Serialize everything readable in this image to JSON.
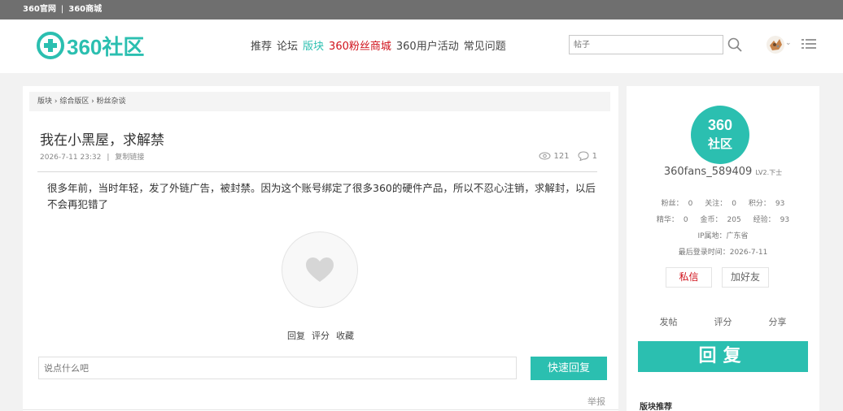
{
  "topbar": {
    "link1": "360官网",
    "sep": "|",
    "link2": "360商城"
  },
  "header": {
    "logo_text": "360社区",
    "nav": [
      {
        "label": "推荐",
        "state": "normal"
      },
      {
        "label": "论坛",
        "state": "normal"
      },
      {
        "label": "版块",
        "state": "active"
      },
      {
        "label": "360粉丝商城",
        "state": "red"
      },
      {
        "label": "360用户活动",
        "state": "normal"
      },
      {
        "label": "常见问题",
        "state": "normal"
      }
    ],
    "search_placeholder": "帖子",
    "icons": {
      "search": "search-icon",
      "avatar": "user-avatar",
      "menu": "list-menu-icon",
      "dropdown": "chevron-down-icon"
    }
  },
  "post": {
    "breadcrumb": "版块 › 综合版区 › 粉丝杂谈",
    "title": "我在小黑屋，求解禁",
    "date": "2026-7-11 23:32",
    "meta_sep": "|",
    "copy_link": "复制链接",
    "views": "121",
    "replies": "1",
    "content": "很多年前，当时年轻，发了外链广告，被封禁。因为这个账号绑定了很多360的硬件产品，所以不忍心注销，求解封，以后不会再犯错了",
    "actions": {
      "reply": "回复",
      "rate": "评分",
      "favorite": "收藏"
    },
    "reply_placeholder": "说点什么吧",
    "quick_reply": "快速回复",
    "report": "举报"
  },
  "sidebar": {
    "avatar_line1": "360",
    "avatar_line2": "社区",
    "username": "360fans_589409",
    "level": "LV2.下士",
    "fans_label": "粉丝：",
    "fans": "0",
    "follow_label": "关注：",
    "follow": "0",
    "points_label": "积分：",
    "points": "93",
    "elite_label": "精华：",
    "elite": "0",
    "coins_label": "金币：",
    "coins": "205",
    "exp_label": "经验：",
    "exp": "93",
    "ip_label": "IP属地：",
    "ip": "广东省",
    "last_login_label": "最后登录时间：",
    "last_login": "2026-7-11",
    "pm_button": "私信",
    "add_friend_button": "加好友",
    "tabs": [
      "发帖",
      "评分",
      "分享"
    ],
    "big_reply": "回复",
    "board_recommend": "版块推荐"
  },
  "colors": {
    "accent": "#2bbfb0",
    "red": "#d0121b",
    "topbar": "#6f6f6f"
  }
}
